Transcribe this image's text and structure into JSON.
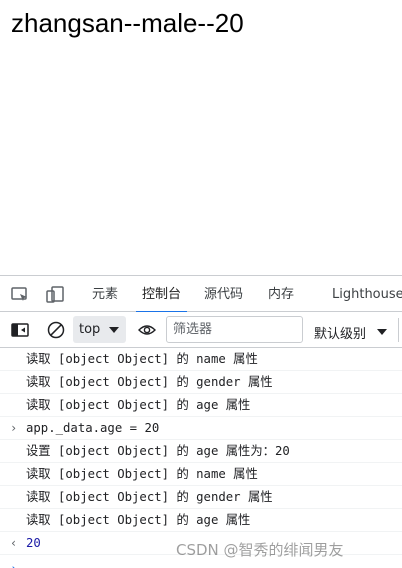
{
  "page": {
    "heading": "zhangsan--male--20"
  },
  "devtools": {
    "tabs": [
      "元素",
      "控制台",
      "源代码",
      "内存",
      "Lighthouse"
    ],
    "active_tab": "控制台",
    "toolbar": {
      "context": "top",
      "filter_placeholder": "筛选器",
      "levels": "默认级别"
    }
  },
  "console": {
    "lines": [
      {
        "kind": "log",
        "text": "读取 [object Object] 的 name 属性"
      },
      {
        "kind": "log",
        "text": "读取 [object Object] 的 gender 属性"
      },
      {
        "kind": "log",
        "text": "读取 [object Object] 的 age 属性"
      },
      {
        "kind": "input",
        "text": "app._data.age = 20"
      },
      {
        "kind": "log",
        "text": "设置 [object Object] 的 age 属性为：20"
      },
      {
        "kind": "log",
        "text": "读取 [object Object] 的 name 属性"
      },
      {
        "kind": "log",
        "text": "读取 [object Object] 的 gender 属性"
      },
      {
        "kind": "log",
        "text": "读取 [object Object] 的 age 属性"
      },
      {
        "kind": "result",
        "text": "20"
      }
    ]
  },
  "watermark": "CSDN @智秀的绯闻男友",
  "colors": {
    "accent": "#1a73e8",
    "result_number": "#1a1aa6"
  }
}
